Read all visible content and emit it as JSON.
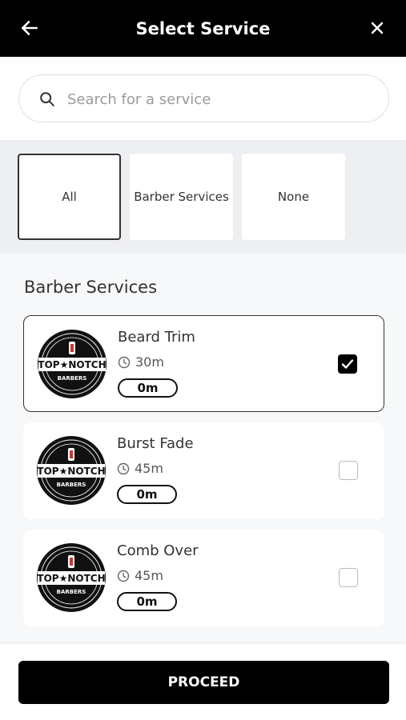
{
  "header": {
    "title": "Select Service",
    "back_icon": "arrow-left-icon",
    "close_icon": "close-icon"
  },
  "search": {
    "placeholder": "Search for a service",
    "value": "",
    "icon": "search-icon"
  },
  "filters": [
    {
      "label": "All",
      "active": true
    },
    {
      "label": "Barber Services",
      "active": false
    },
    {
      "label": "None",
      "active": false
    }
  ],
  "section": {
    "title": "Barber Services"
  },
  "services": [
    {
      "name": "Beard Trim",
      "duration": "30m",
      "price_time": "0m",
      "selected": true,
      "logo_text": "TOP★NOTCH",
      "logo_sub": "BARBERS"
    },
    {
      "name": "Burst Fade",
      "duration": "45m",
      "price_time": "0m",
      "selected": false,
      "logo_text": "TOP★NOTCH",
      "logo_sub": "BARBERS"
    },
    {
      "name": "Comb Over",
      "duration": "45m",
      "price_time": "0m",
      "selected": false,
      "logo_text": "TOP★NOTCH",
      "logo_sub": "BARBERS"
    }
  ],
  "footer": {
    "proceed_label": "PROCEED"
  },
  "colors": {
    "primary": "#000000",
    "background": "#f7f8fa",
    "filter_bg": "#eeeff2"
  }
}
